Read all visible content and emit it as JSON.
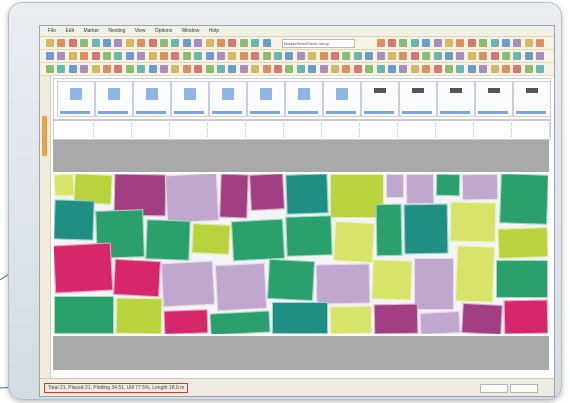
{
  "window": {
    "menu": [
      "File",
      "Edit",
      "Marker",
      "Nesting",
      "View",
      "Options",
      "Window",
      "Help"
    ]
  },
  "toolbar": {
    "field_label": "Marker/Nest/Fabric setup"
  },
  "statusbar": {
    "text": "Total 21, Placed 21, Plotting 34.51, Util 77.5%, Length 18.0 m"
  },
  "colors": {
    "magenta": "#d6276d",
    "purple": "#a23f83",
    "lavender": "#c0a7cd",
    "green": "#2aa06c",
    "teal": "#1f8f83",
    "lime": "#b9d33c",
    "light_lime": "#d8e36a",
    "accent_red": "#cc3a30"
  }
}
